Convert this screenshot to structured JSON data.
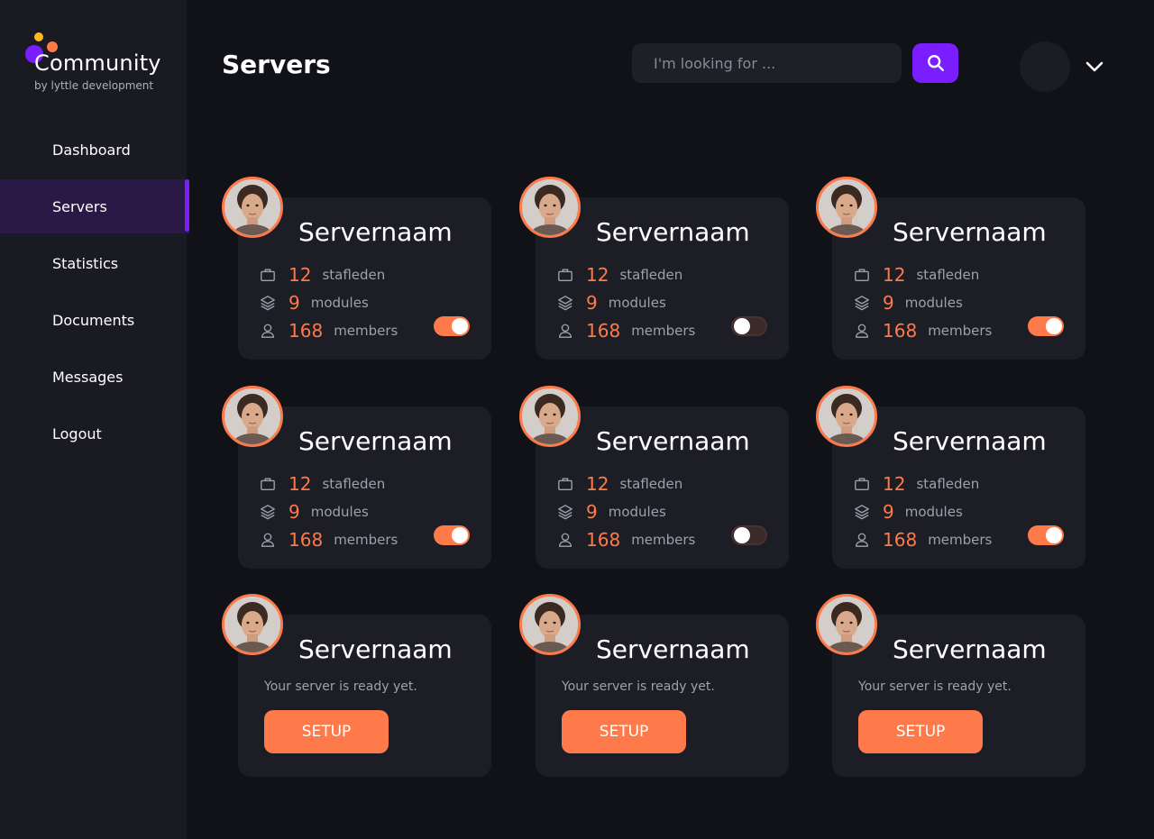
{
  "brand": {
    "name": "Community",
    "subtitle": "by lyttle development",
    "colors": {
      "purple": "#7a1dff",
      "orange": "#ff7a4a",
      "yellow": "#ffb820"
    }
  },
  "sidebar": {
    "items": [
      {
        "label": "Dashboard",
        "active": false
      },
      {
        "label": "Servers",
        "active": true
      },
      {
        "label": "Statistics",
        "active": false
      },
      {
        "label": "Documents",
        "active": false
      },
      {
        "label": "Messages",
        "active": false
      },
      {
        "label": "Logout",
        "active": false
      }
    ]
  },
  "header": {
    "title": "Servers",
    "search_placeholder": "I'm looking for ...",
    "search_icon": "search-icon",
    "profile_icon": "avatar",
    "menu_icon": "chevron-down-icon"
  },
  "servers": [
    {
      "name": "Servernaam",
      "staff_count": "12",
      "staff_label": "stafleden",
      "modules_count": "9",
      "modules_label": "modules",
      "members_count": "168",
      "members_label": "members",
      "enabled": true
    },
    {
      "name": "Servernaam",
      "staff_count": "12",
      "staff_label": "stafleden",
      "modules_count": "9",
      "modules_label": "modules",
      "members_count": "168",
      "members_label": "members",
      "enabled": false
    },
    {
      "name": "Servernaam",
      "staff_count": "12",
      "staff_label": "stafleden",
      "modules_count": "9",
      "modules_label": "modules",
      "members_count": "168",
      "members_label": "members",
      "enabled": true
    },
    {
      "name": "Servernaam",
      "staff_count": "12",
      "staff_label": "stafleden",
      "modules_count": "9",
      "modules_label": "modules",
      "members_count": "168",
      "members_label": "members",
      "enabled": true
    },
    {
      "name": "Servernaam",
      "staff_count": "12",
      "staff_label": "stafleden",
      "modules_count": "9",
      "modules_label": "modules",
      "members_count": "168",
      "members_label": "members",
      "enabled": false
    },
    {
      "name": "Servernaam",
      "staff_count": "12",
      "staff_label": "stafleden",
      "modules_count": "9",
      "modules_label": "modules",
      "members_count": "168",
      "members_label": "members",
      "enabled": true
    }
  ],
  "pending_servers": [
    {
      "name": "Servernaam",
      "status_text": "Your server is ready yet.",
      "button_label": "SETUP"
    },
    {
      "name": "Servernaam",
      "status_text": "Your server is ready yet.",
      "button_label": "SETUP"
    },
    {
      "name": "Servernaam",
      "status_text": "Your server is ready yet.",
      "button_label": "SETUP"
    }
  ]
}
